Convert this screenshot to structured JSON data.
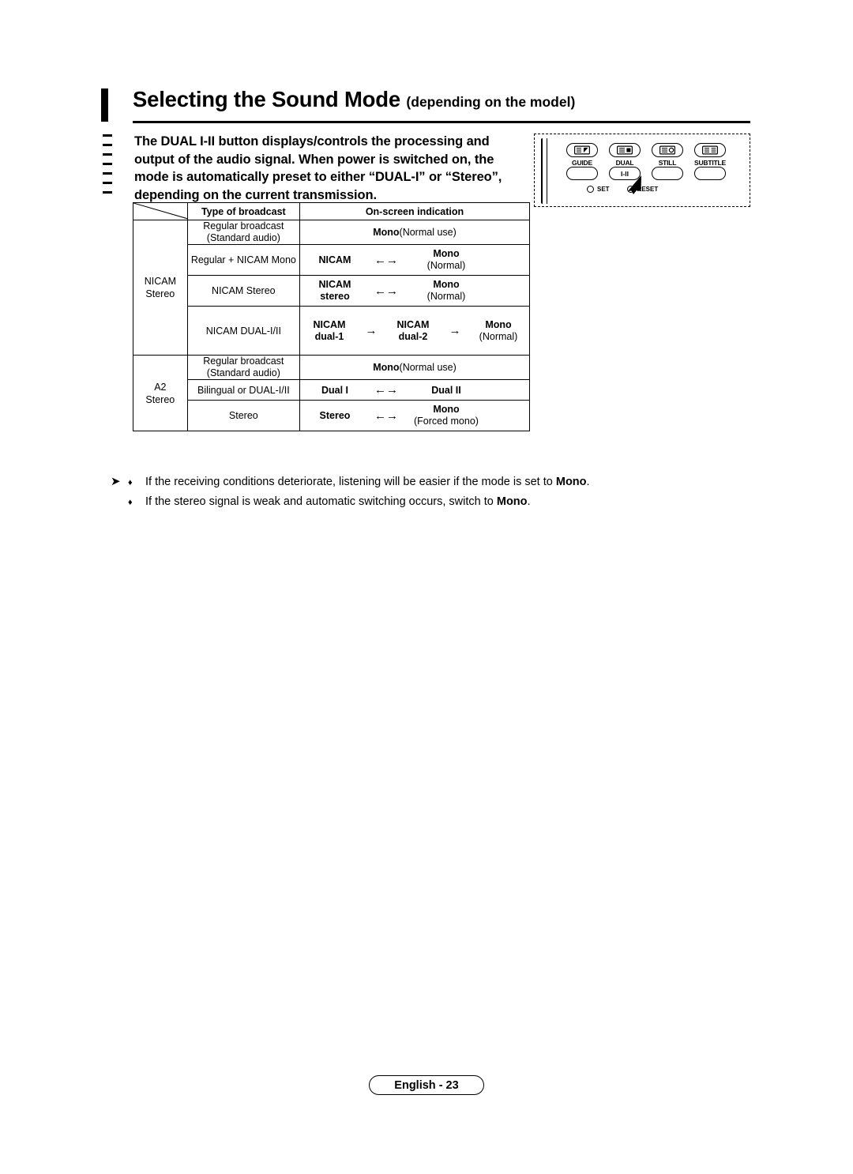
{
  "header": {
    "title": "Selecting the Sound Mode",
    "title_suffix": "(depending on the model)"
  },
  "intro": {
    "text": "The DUAL I-II button displays/controls the processing and output of the audio signal. When power is switched on, the mode is automatically preset to either “DUAL-I” or “Stereo”, depending on the current transmission."
  },
  "remote": {
    "buttons_top": [
      "guide-icon",
      "dual-icon",
      "still-icon",
      "subtitle-icon"
    ],
    "labels": [
      "GUIDE",
      "DUAL",
      "STILL",
      "SUBTITLE"
    ],
    "button_dual": "I-II",
    "set_label": "SET",
    "reset_label": "RESET"
  },
  "table": {
    "headers": {
      "corner": "",
      "type": "Type of broadcast",
      "indication": "On-screen indication"
    },
    "groups": [
      {
        "name": "NICAM\nStereo",
        "name_lines": [
          "NICAM",
          "Stereo"
        ],
        "rows": [
          {
            "type_lines": [
              "Regular broadcast",
              "(Standard audio)"
            ],
            "indication": {
              "kind": "single",
              "items": [
                {
                  "bold": "Mono",
                  "plain": " (Normal use)"
                }
              ]
            }
          },
          {
            "type_lines": [
              "Regular + NICAM Mono"
            ],
            "indication": {
              "kind": "pair",
              "left": {
                "bold": "NICAM"
              },
              "arrow": "←→",
              "right": {
                "bold": "Mono",
                "sub": "(Normal)"
              }
            }
          },
          {
            "type_lines": [
              "NICAM Stereo"
            ],
            "indication": {
              "kind": "pair",
              "left": {
                "bold": "NICAM",
                "sub_bold": "stereo"
              },
              "arrow": "←→",
              "right": {
                "bold": "Mono",
                "sub": "(Normal)"
              }
            }
          },
          {
            "type_lines": [
              "NICAM DUAL-I/II"
            ],
            "indication": {
              "kind": "triple",
              "a": {
                "bold": "NICAM",
                "sub_bold": "dual-1"
              },
              "arrow1": "→",
              "b": {
                "bold": "NICAM",
                "sub_bold": "dual-2"
              },
              "arrow2": "→",
              "c": {
                "bold": "Mono",
                "sub": "(Normal)"
              }
            }
          }
        ]
      },
      {
        "name_lines": [
          "A2",
          "Stereo"
        ],
        "rows": [
          {
            "type_lines": [
              "Regular broadcast",
              "(Standard audio)"
            ],
            "indication": {
              "kind": "single",
              "items": [
                {
                  "bold": "Mono",
                  "plain": " (Normal use)"
                }
              ]
            }
          },
          {
            "type_lines": [
              "Bilingual or DUAL-I/II"
            ],
            "indication": {
              "kind": "pair",
              "left": {
                "bold": "Dual I"
              },
              "arrow": "←→",
              "right": {
                "bold": "Dual II"
              }
            }
          },
          {
            "type_lines": [
              "Stereo"
            ],
            "indication": {
              "kind": "pair",
              "left": {
                "bold": "Stereo"
              },
              "arrow": "←→",
              "right": {
                "bold": "Mono",
                "sub": "(Forced mono)"
              }
            }
          }
        ]
      }
    ]
  },
  "notes": {
    "arrow": "➤",
    "diamond": "♦",
    "items": [
      {
        "pre": "If the receiving conditions deteriorate, listening will be easier if the mode is set to ",
        "bold": "Mono",
        "post": "."
      },
      {
        "pre": "If the stereo signal is weak and automatic switching occurs, switch to ",
        "bold": "Mono",
        "post": "."
      }
    ]
  },
  "footer": {
    "page_label": "English - 23"
  }
}
